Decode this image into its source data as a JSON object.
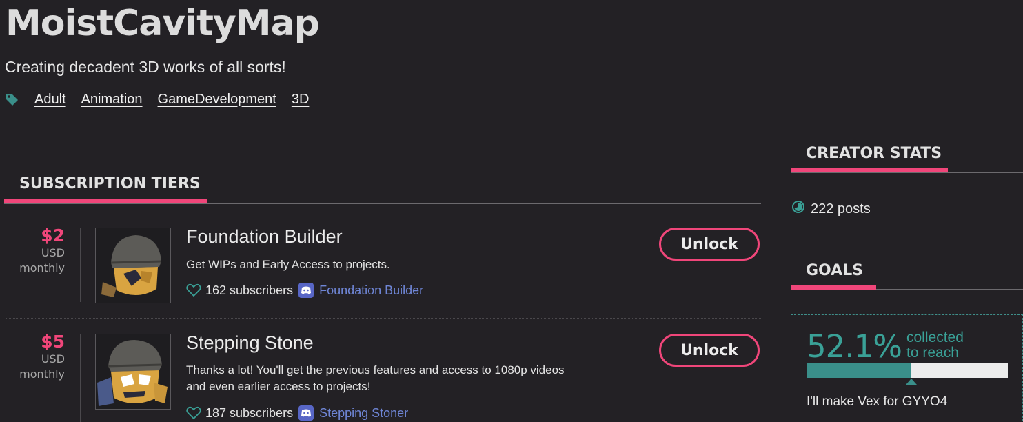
{
  "header": {
    "title": "MoistCavityMap",
    "tagline": "Creating decadent 3D works of all sorts!",
    "tags": [
      "Adult",
      "Animation",
      "GameDevelopment",
      "3D"
    ],
    "tag_icon": "tag-icon"
  },
  "sections": {
    "tiers_heading": "SUBSCRIPTION TIERS",
    "stats_heading": "CREATOR STATS",
    "goals_heading": "GOALS"
  },
  "tiers": [
    {
      "price": "$2",
      "currency": "USD",
      "period": "monthly",
      "name": "Foundation Builder",
      "description": "Get WIPs and Early Access to projects.",
      "subscribers": "162 subscribers",
      "discord_role": "Foundation Builder",
      "unlock_label": "Unlock"
    },
    {
      "price": "$5",
      "currency": "USD",
      "period": "monthly",
      "name": "Stepping Stone",
      "description": "Thanks a lot! You'll get the previous features and access to 1080p videos and even earlier access to projects!",
      "subscribers": "187 subscribers",
      "discord_role": "Stepping Stoner",
      "unlock_label": "Unlock"
    }
  ],
  "stats": {
    "posts": "222 posts"
  },
  "goal": {
    "percent_text": "52.1%",
    "percent_value": 52.1,
    "label_line1": "collected",
    "label_line2": "to reach",
    "description": "I'll make Vex for GYYO4"
  },
  "colors": {
    "accent": "#f0467a",
    "teal": "#3aa197",
    "background": "#232125",
    "discord": "#6f86d6"
  }
}
